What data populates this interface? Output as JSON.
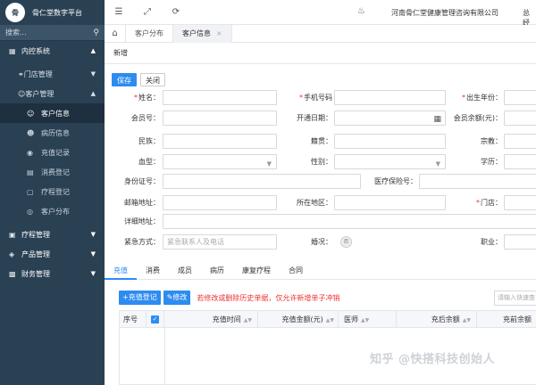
{
  "app": {
    "title": "骨仁堂数字平台",
    "logo_text": "骨"
  },
  "sidebar": {
    "search_placeholder": "搜索...",
    "top_group": "内控系统",
    "sections": [
      {
        "label": "门店管理"
      },
      {
        "label": "客户管理"
      }
    ],
    "items": [
      {
        "label": "客户信息"
      },
      {
        "label": "病历信息"
      },
      {
        "label": "充值记录"
      },
      {
        "label": "消费登记"
      },
      {
        "label": "疗程登记"
      },
      {
        "label": "客户分布"
      }
    ],
    "groups": [
      {
        "label": "疗程管理"
      },
      {
        "label": "产品管理"
      },
      {
        "label": "财务管理"
      }
    ]
  },
  "topbar": {
    "company": "河南骨仁堂健康管理咨询有限公司",
    "user": "总经"
  },
  "tabs": [
    {
      "label": "客户分布"
    },
    {
      "label": "客户信息"
    }
  ],
  "breadcrumb": "新增",
  "buttons": {
    "save": "保存",
    "close": "关闭"
  },
  "form": {
    "name": "姓名：",
    "phone": "手机号码",
    "birth": "出生年份：",
    "member_no": "会员号：",
    "open_date": "开通日期：",
    "balance": "会员余额(元)：",
    "ethnic": "民族：",
    "origin": "籍贯：",
    "religion": "宗教：",
    "blood": "血型：",
    "gender": "性别：",
    "edu": "学历：",
    "id_card": "身份证号：",
    "insurance": "医疗保险号：",
    "address": "邮箱地址：",
    "region": "所在地区：",
    "store": "门店：",
    "detail_address": "详细地址：",
    "contact": "紧急方式：",
    "contact_placeholder": "紧急联系人及电话",
    "marriage": "婚况：",
    "radio_text": "否",
    "job": "职业："
  },
  "subtabs": [
    {
      "label": "充值"
    },
    {
      "label": "消费"
    },
    {
      "label": "成员"
    },
    {
      "label": "病历"
    },
    {
      "label": "康复疗程"
    },
    {
      "label": "合同"
    }
  ],
  "actions": {
    "add": "充值登记",
    "edit": "修改",
    "warning": "若修改或删除历史单据，仅允许新增单子冲销",
    "search_placeholder": "请输入快速查"
  },
  "table": {
    "columns": [
      "序号",
      "充值时间",
      "充值金额(元)",
      "医师",
      "充后余额",
      "充前余额"
    ]
  },
  "watermark": "知乎 @快搭科技创始人",
  "colors": {
    "sidebar": "#2a4154",
    "accent": "#2d8cf0",
    "warning": "#e33333"
  }
}
